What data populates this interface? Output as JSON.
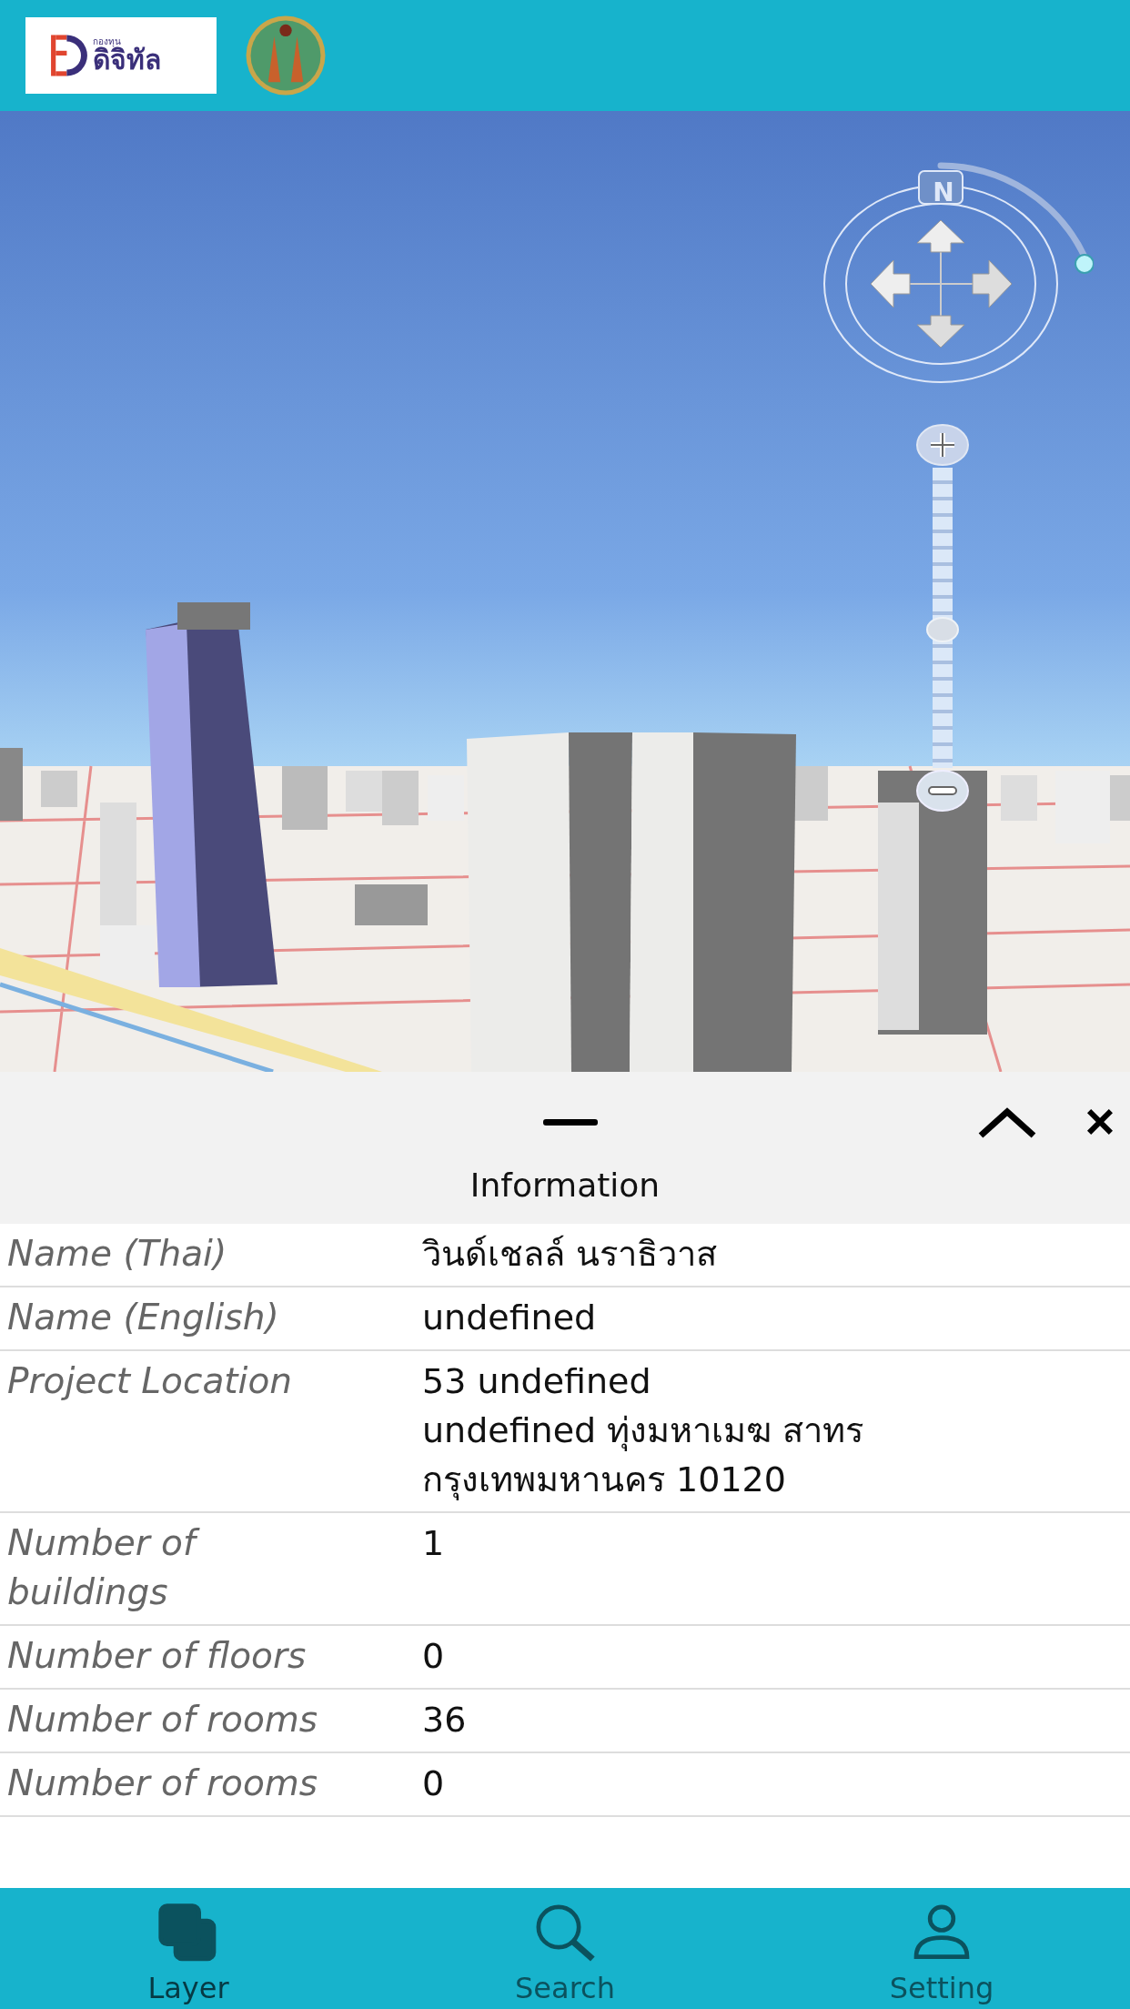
{
  "header": {
    "logo": {
      "small_text": "กองทุน",
      "main_text": "ดิจิทัล"
    }
  },
  "map": {
    "compass_label": "N",
    "zoom_slider": {
      "level": 0.46
    }
  },
  "info_panel": {
    "title": "Information",
    "rows": [
      {
        "label": "Name (Thai)",
        "value": [
          "วินด์เชลล์ นราธิวาส"
        ]
      },
      {
        "label": "Name (English)",
        "value": [
          "undefined"
        ]
      },
      {
        "label": "Project Location",
        "value": [
          "53 undefined",
          "undefined ทุ่งมหาเมฆ สาทร",
          "กรุงเทพมหานคร 10120"
        ]
      },
      {
        "label": "Number of buildings",
        "value": [
          "1"
        ]
      },
      {
        "label": "Number of floors",
        "value": [
          "0"
        ]
      },
      {
        "label": "Number of rooms",
        "value": [
          "36"
        ]
      },
      {
        "label": "Number of rooms",
        "value": [
          "0"
        ]
      }
    ]
  },
  "bottom_nav": [
    {
      "kind": "layer",
      "label": "Layer",
      "selected": true
    },
    {
      "kind": "search",
      "label": "Search",
      "selected": false
    },
    {
      "kind": "user",
      "label": "Setting",
      "selected": false
    }
  ]
}
